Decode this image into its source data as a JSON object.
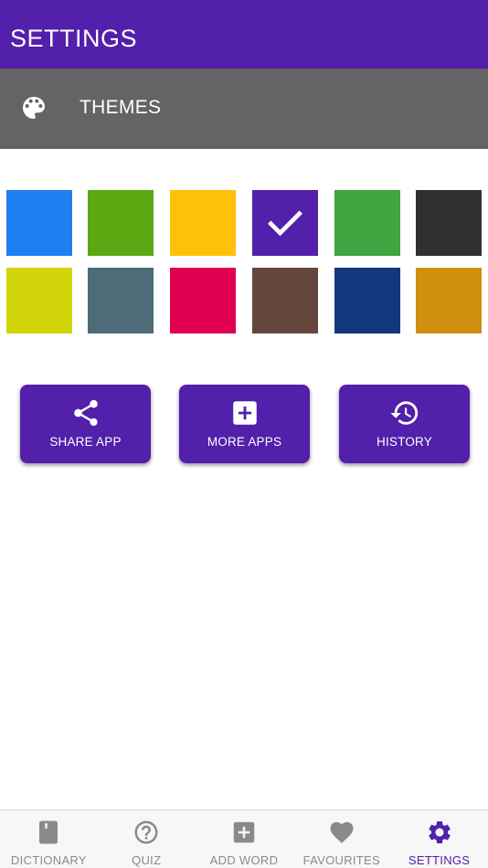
{
  "header": {
    "title": "SETTINGS",
    "color": "#5220aa"
  },
  "themes_row": {
    "label": "THEMES",
    "icon": "palette-icon",
    "background": "#646464"
  },
  "themes": {
    "selected_index": 3,
    "colors": [
      "#1e7ff0",
      "#5ba912",
      "#fec10a",
      "#5220aa",
      "#40a440",
      "#303030",
      "#d1d50a",
      "#4e6b78",
      "#e00051",
      "#65463c",
      "#12377c",
      "#cf9010"
    ]
  },
  "actions": [
    {
      "label": "SHARE APP",
      "icon": "share-icon"
    },
    {
      "label": "MORE APPS",
      "icon": "plus-box-icon"
    },
    {
      "label": "HISTORY",
      "icon": "history-icon"
    }
  ],
  "tabs": [
    {
      "label": "DICTIONARY",
      "icon": "book-icon",
      "active": false
    },
    {
      "label": "QUIZ",
      "icon": "question-circle-icon",
      "active": false
    },
    {
      "label": "ADD WORD",
      "icon": "plus-box-icon",
      "active": false
    },
    {
      "label": "FAVOURITES",
      "icon": "heart-icon",
      "active": false
    },
    {
      "label": "SETTINGS",
      "icon": "gear-icon",
      "active": true
    }
  ]
}
